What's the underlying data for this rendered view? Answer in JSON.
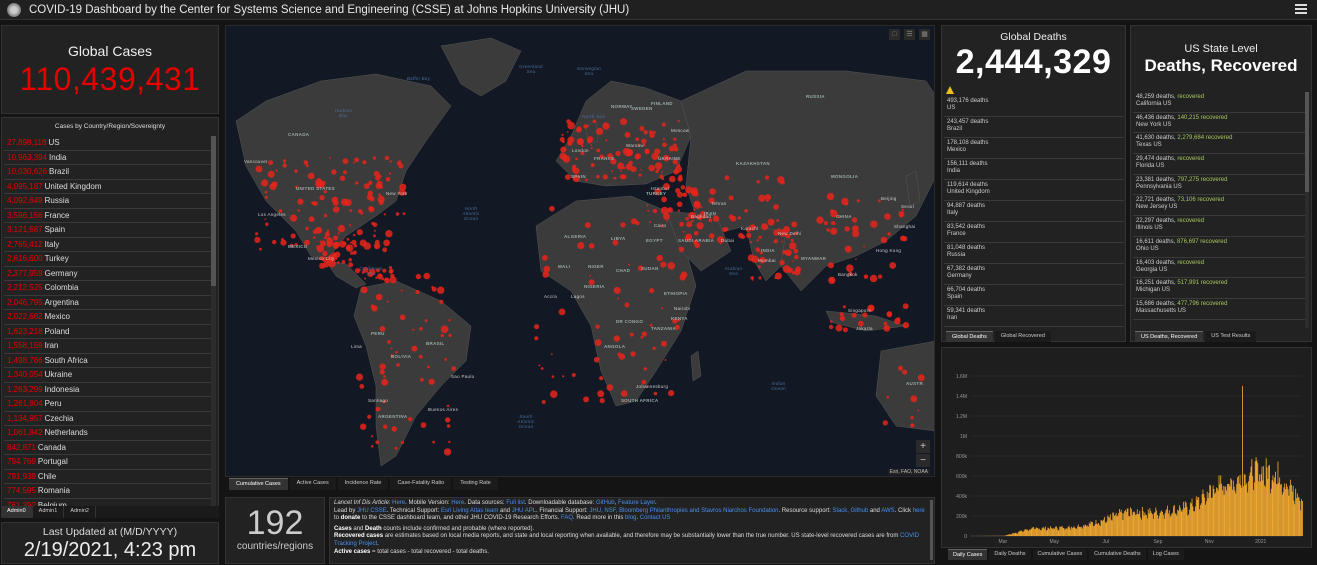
{
  "header": {
    "title": "COVID-19 Dashboard by the Center for Systems Science and Engineering (CSSE) at Johns Hopkins University (JHU)"
  },
  "global_cases": {
    "label": "Global Cases",
    "value": "110,439,431"
  },
  "country_list": {
    "title": "Cases by Country/Region/Sovereignty",
    "items": [
      {
        "value": "27,898,118",
        "name": "US"
      },
      {
        "value": "10,963,394",
        "name": "India"
      },
      {
        "value": "10,030,626",
        "name": "Brazil"
      },
      {
        "value": "4,095,187",
        "name": "United Kingdom"
      },
      {
        "value": "4,092,649",
        "name": "Russia"
      },
      {
        "value": "3,596,156",
        "name": "France"
      },
      {
        "value": "3,121,687",
        "name": "Spain"
      },
      {
        "value": "2,765,412",
        "name": "Italy"
      },
      {
        "value": "2,616,600",
        "name": "Turkey"
      },
      {
        "value": "2,377,959",
        "name": "Germany"
      },
      {
        "value": "2,212,525",
        "name": "Colombia"
      },
      {
        "value": "2,046,795",
        "name": "Argentina"
      },
      {
        "value": "2,022,662",
        "name": "Mexico"
      },
      {
        "value": "1,623,218",
        "name": "Poland"
      },
      {
        "value": "1,558,159",
        "name": "Iran"
      },
      {
        "value": "1,498,766",
        "name": "South Africa"
      },
      {
        "value": "1,340,054",
        "name": "Ukraine"
      },
      {
        "value": "1,263,299",
        "name": "Indonesia"
      },
      {
        "value": "1,261,804",
        "name": "Peru"
      },
      {
        "value": "1,134,957",
        "name": "Czechia"
      },
      {
        "value": "1,061,842",
        "name": "Netherlands"
      },
      {
        "value": "842,871",
        "name": "Canada"
      },
      {
        "value": "794,769",
        "name": "Portugal"
      },
      {
        "value": "791,939",
        "name": "Chile"
      },
      {
        "value": "774,595",
        "name": "Romania"
      },
      {
        "value": "761,392",
        "name": "Belgium"
      }
    ]
  },
  "admin_tabs": [
    "Admin0",
    "Admin1",
    "Admin2"
  ],
  "last_updated": {
    "label": "Last Updated at (M/D/YYYY)",
    "value": "2/19/2021, 4:23 pm"
  },
  "map": {
    "labels": {
      "canada": "CANADA",
      "united_states": "UNITED STATES",
      "mexico": "MEXICO",
      "brazil": "BRASIL",
      "peru": "PERU",
      "bolivia": "BOLIVIA",
      "argentina": "ARGENTINA",
      "russia": "RUSSIA",
      "kazakhstan": "KAZAKHSTAN",
      "mongolia": "MONGOLIA",
      "china": "CHINA",
      "india": "INDIA",
      "algeria": "ALGERIA",
      "libya": "LIBYA",
      "egypt": "EGYPT",
      "saudi": "SAUDI ARABIA",
      "mali": "MALI",
      "niger": "NIGER",
      "chad": "CHAD",
      "sudan": "SUDAN",
      "nigeria": "NIGERIA",
      "ethiopia": "ETHIOPIA",
      "drcongo": "DR CONGO",
      "tanzania": "TANZANIA",
      "angola": "ANGOLA",
      "south_africa": "SOUTH AFRICA",
      "iran": "IRAN",
      "turkey": "TURKEY",
      "norway": "NORWAY",
      "sweden": "SWEDEN",
      "finland": "FINLAND",
      "france": "FRANCE",
      "spain": "SPAIN",
      "ukraine": "UKRAINE",
      "kenya": "KENYA",
      "myanmar": "MYANMAR",
      "australia": "AUSTR",
      "north_atlantic": "North Atlantic Ocean",
      "south_atlantic": "South Atlantic Ocean",
      "indian_ocean": "Indian Ocean",
      "arabian_sea": "Arabian Sea",
      "caribbean": "Caribbean Sea",
      "hudson_bay": "Hudson Bay",
      "baffin": "Baffin Bay",
      "greenland_sea": "Greenland Sea",
      "norwegian_sea": "Norwegian Sea",
      "north_sea": "North Sea",
      "vancouver": "Vancouver",
      "new_york": "New York",
      "los_angeles": "Los Angeles",
      "mexico_city": "Mexico City",
      "lima": "Lima",
      "sao_paulo": "Sao Paulo",
      "buenos_aires": "Buenos Aires",
      "london": "London",
      "moscow": "Moscow",
      "warsaw": "Warsaw",
      "istanbul": "Istanbul",
      "cairo": "Cairo",
      "baghdad": "Baghdad",
      "tehran": "Tehran",
      "dubai": "Dubai",
      "lagos": "Lagos",
      "accra": "Accra",
      "nairobi": "Nairobi",
      "karachi": "Karachi",
      "new_delhi": "New Delhi",
      "mumbai": "Mumbai",
      "bangkok": "Bangkok",
      "hong_kong": "Hong Kong",
      "beijing": "Beijing",
      "shanghai": "Shanghai",
      "seoul": "Seoul",
      "singapore": "Singapore",
      "jakarta": "Jakarta",
      "johannesburg": "Johannesburg",
      "santiago": "Santiago"
    },
    "attribution": "Esri, FAO, NOAA",
    "zoom_in": "+",
    "zoom_out": "−",
    "tabs": [
      "Cumulative Cases",
      "Active Cases",
      "Incidence Rate",
      "Case-Fatality Ratio",
      "Testing Rate"
    ],
    "dot_color": "#e8241b"
  },
  "countries": {
    "value": "192",
    "label": "countries/regions"
  },
  "info": {
    "p1a": "Lancet Inf Dis Article: ",
    "here1": "Here",
    "p1b": ". Mobile Version: ",
    "here2": "Here",
    "p1c": ". Data sources: ",
    "fulllist": "Full list",
    "p1d": ". Downloadable database: ",
    "github": "GitHub",
    "p1e": ", ",
    "feature": "Feature Layer",
    "p1f": ".",
    "p2a": "Lead by ",
    "jhucsse": "JHU CSSE",
    "p2b": ". Technical Support: ",
    "esri": "Esri Living Atlas team",
    "p2c": " and ",
    "jhuapl": "JHU APL",
    "p2d": ". Financial Support: ",
    "jhunsf": "JHU, NSF, Bloomberg Philanthropies and Stavros Niarchos Foundation",
    "p2e": ". Resource support: ",
    "slack": "Slack, Github",
    "p2f": " and ",
    "aws": "AWS",
    "p2g": ". Click ",
    "here3": "here",
    "p2h": " to ",
    "donate": "donate",
    "p2i": " to the CSSE dashboard team, and other JHU COVID-19 Research Efforts. ",
    "faq": "FAQ",
    "p2j": ". Read more in this ",
    "blog": "blog",
    "p2k": ". ",
    "contact": "Contact US",
    "p3a": "Cases",
    "p3b": " and ",
    "p3c": "Death",
    "p3d": " counts include confirmed and probable (where reported).",
    "p4a": "Recovered cases",
    "p4b": " are estimates based on local media reports, and state and local reporting when available, and therefore may be substantially lower than the true number. US state-level recovered cases are from ",
    "ctp": "COVID Tracking Project",
    "p4c": ".",
    "p5a": "Active cases",
    "p5b": " = total cases - total recovered - total deaths."
  },
  "global_deaths": {
    "label": "Global Deaths",
    "value": "2,444,329",
    "items": [
      {
        "count": "493,176 deaths",
        "name": "US"
      },
      {
        "count": "243,457 deaths",
        "name": "Brazil"
      },
      {
        "count": "178,108 deaths",
        "name": "Mexico"
      },
      {
        "count": "156,111 deaths",
        "name": "India"
      },
      {
        "count": "119,614 deaths",
        "name": "United Kingdom"
      },
      {
        "count": "94,887 deaths",
        "name": "Italy"
      },
      {
        "count": "83,542 deaths",
        "name": "France"
      },
      {
        "count": "81,048 deaths",
        "name": "Russia"
      },
      {
        "count": "67,382 deaths",
        "name": "Germany"
      },
      {
        "count": "66,704 deaths",
        "name": "Spain"
      },
      {
        "count": "59,341 deaths",
        "name": "Iran"
      },
      {
        "count": "",
        "name": ""
      }
    ],
    "tabs": [
      "Global Deaths",
      "Global Recovered"
    ]
  },
  "us_state": {
    "label": "US State Level",
    "value": "Deaths, Recovered",
    "items": [
      {
        "deaths": "48,259 deaths,",
        "recovered": "recovered",
        "name": "California US"
      },
      {
        "deaths": "46,436 deaths,",
        "recovered": "140,215 recovered",
        "name": "New York US"
      },
      {
        "deaths": "41,630 deaths,",
        "recovered": "2,279,684 recovered",
        "name": "Texas US"
      },
      {
        "deaths": "29,474 deaths,",
        "recovered": "recovered",
        "name": "Florida US"
      },
      {
        "deaths": "23,381 deaths,",
        "recovered": "797,275 recovered",
        "name": "Pennsylvania US"
      },
      {
        "deaths": "22,721 deaths,",
        "recovered": "73,106 recovered",
        "name": "New Jersey US"
      },
      {
        "deaths": "22,297 deaths,",
        "recovered": "recovered",
        "name": "Illinois US"
      },
      {
        "deaths": "16,611 deaths,",
        "recovered": "876,697 recovered",
        "name": "Ohio US"
      },
      {
        "deaths": "16,403 deaths,",
        "recovered": "recovered",
        "name": "Georgia US"
      },
      {
        "deaths": "16,251 deaths,",
        "recovered": "517,991 recovered",
        "name": "Michigan US"
      },
      {
        "deaths": "15,686 deaths,",
        "recovered": "477,796 recovered",
        "name": "Massachusetts US"
      },
      {
        "deaths": "",
        "recovered": "",
        "name": ""
      }
    ],
    "tabs": [
      "US Deaths, Recovered",
      "US Test Results"
    ]
  },
  "chart_tabs": [
    "Daily Cases",
    "Daily Deaths",
    "Cumulative Cases",
    "Cumulative Deaths",
    "Log Cases"
  ],
  "chart_data": {
    "type": "bar",
    "title": "",
    "xlabel": "",
    "ylabel": "",
    "color": "#f0a830",
    "ylim": [
      0,
      1800000
    ],
    "yticks": [
      "0",
      "200k",
      "400k",
      "600k",
      "800k",
      "1M",
      "1.2M",
      "1.4M",
      "1.6M"
    ],
    "xticks": [
      "Mar",
      "May",
      "Jul",
      "Sep",
      "Nov",
      "2021"
    ],
    "x_start": "2020-01-22",
    "x_end": "2021-02-19",
    "smooth": [
      [
        0,
        0
      ],
      [
        40,
        2000
      ],
      [
        55,
        40000
      ],
      [
        70,
        80000
      ],
      [
        80,
        85000
      ],
      [
        100,
        90000
      ],
      [
        120,
        100000
      ],
      [
        140,
        130000
      ],
      [
        160,
        180000
      ],
      [
        175,
        240000
      ],
      [
        185,
        270000
      ],
      [
        200,
        270000
      ],
      [
        215,
        260000
      ],
      [
        230,
        280000
      ],
      [
        245,
        300000
      ],
      [
        260,
        330000
      ],
      [
        270,
        380000
      ],
      [
        280,
        460000
      ],
      [
        290,
        540000
      ],
      [
        300,
        590000
      ],
      [
        310,
        600000
      ],
      [
        320,
        640000
      ],
      [
        330,
        700000
      ],
      [
        340,
        720000
      ],
      [
        350,
        720000
      ],
      [
        360,
        700000
      ],
      [
        365,
        690000
      ],
      [
        372,
        620000
      ],
      [
        380,
        530000
      ],
      [
        388,
        440000
      ],
      [
        394,
        390000
      ]
    ],
    "spike": {
      "day": 323,
      "value": 1500000
    }
  }
}
